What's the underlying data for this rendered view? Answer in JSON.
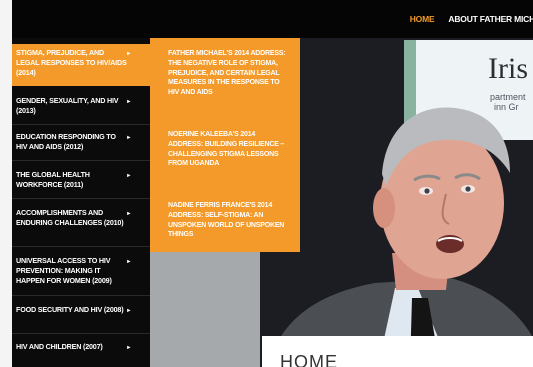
{
  "nav": {
    "items": [
      {
        "label": "HOME",
        "active": true
      },
      {
        "label": "ABOUT FATHER MICHA",
        "active": false
      }
    ]
  },
  "menu": {
    "items": [
      {
        "label": "STIGMA, PREJUDICE, AND LEGAL RESPONSES TO HIV/AIDS (2014)",
        "active": true
      },
      {
        "label": "GENDER, SEXUALITY, AND HIV (2013)",
        "active": false
      },
      {
        "label": "EDUCATION RESPONDING TO HIV AND AIDS (2012)",
        "active": false
      },
      {
        "label": "THE GLOBAL HEALTH WORKFORCE (2011)",
        "active": false
      },
      {
        "label": "ACCOMPLISHMENTS AND ENDURING CHALLENGES (2010)",
        "active": false
      },
      {
        "label": "UNIVERSAL ACCESS TO HIV PREVENTION: MAKING IT HAPPEN FOR WOMEN (2009)",
        "active": false
      },
      {
        "label": "FOOD SECURITY AND HIV (2008)",
        "active": false
      },
      {
        "label": "HIV AND CHILDREN (2007)",
        "active": false
      }
    ],
    "arrow": "▸"
  },
  "submenu": {
    "items": [
      {
        "label": "FATHER MICHAEL'S 2014 ADDRESS: THE NEGATIVE ROLE OF STIGMA, PREJUDICE, AND CERTAIN LEGAL MEASURES IN THE RESPONSE TO HIV AND AIDS"
      },
      {
        "label": "NOERINE KALEEBA'S 2014 ADDRESS: BUILDING RESILIENCE – CHALLENGING STIGMA LESSONS FROM UGANDA"
      },
      {
        "label": "NADINE FERRIS FRANCE'S 2014 ADDRESS: SELF-STIGMA: AN UNSPOKEN WORLD OF UNSPOKEN THINGS"
      }
    ]
  },
  "photo": {
    "sign_text": "Iris",
    "sign_sub1": "partment",
    "sign_sub2": "inn Gr"
  },
  "content": {
    "title": "HOME"
  },
  "colors": {
    "accent": "#f39a2a",
    "nav_bg": "#050505",
    "menu_bg": "#0b0b0b"
  }
}
